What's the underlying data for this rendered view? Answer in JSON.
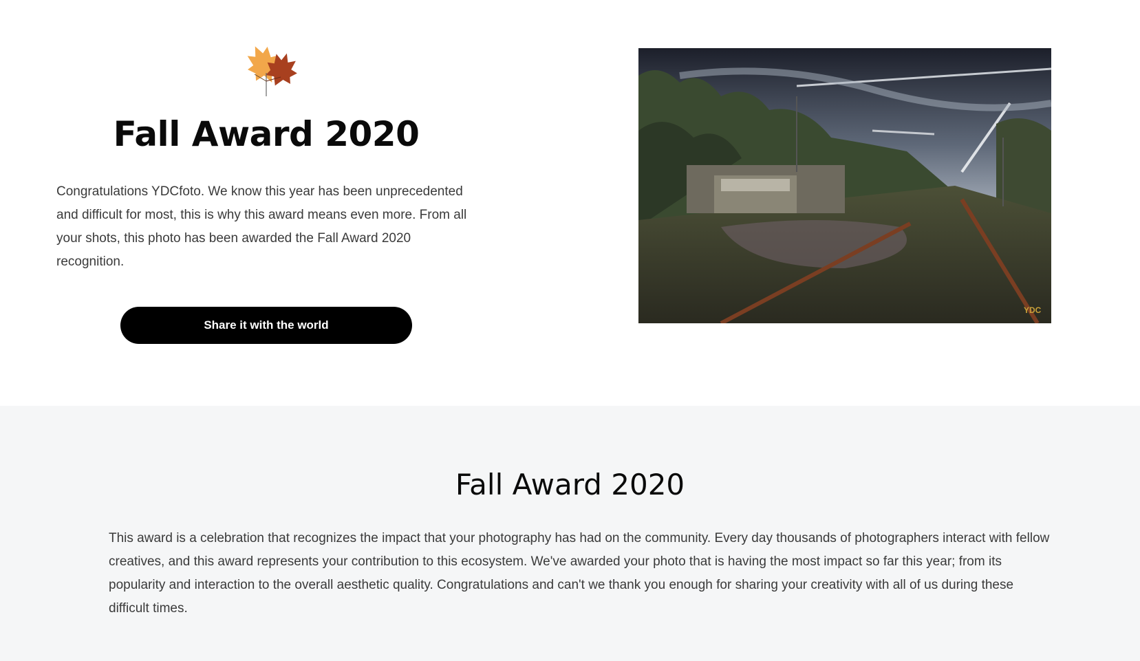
{
  "hero": {
    "icon": "maple-leaf-icon",
    "title": "Fall Award 2020",
    "text": "Congratulations YDCfoto. We know this year has been unprecedented and difficult for most, this is why this award means even more. From all your shots, this photo has been awarded the Fall Award 2020 recognition.",
    "share_label": "Share it with the world"
  },
  "photo": {
    "watermark": "YDC"
  },
  "info": {
    "title": "Fall Award 2020",
    "text": "This award is a celebration that recognizes the impact that your photography has had on the community. Every day thousands of photographers interact with fellow creatives, and this award represents your contribution to this ecosystem. We've awarded your photo that is having the most impact so far this year; from its popularity and interaction to the overall aesthetic quality. Congratulations and can't we thank you enough for sharing your creativity with all of us during these difficult times."
  },
  "colors": {
    "leaf_light": "#f2a74a",
    "leaf_dark": "#b04a24",
    "button_bg": "#000000",
    "section_bg": "#f5f6f7"
  }
}
